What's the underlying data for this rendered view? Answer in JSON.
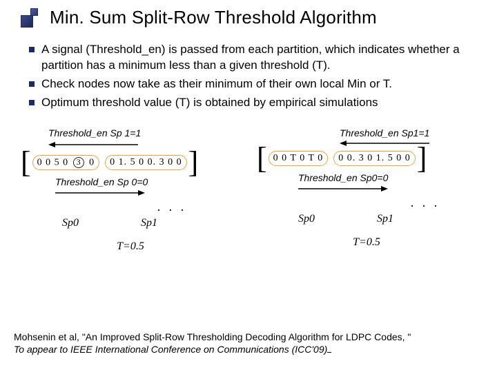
{
  "title": "Min. Sum Split-Row Threshold Algorithm",
  "bullets": [
    "A signal (Threshold_en) is passed from each partition, which indicates whether a partition has a minimum less than a given threshold (T).",
    "Check nodes now take as their minimum of their own local Min or T.",
    "Optimum threshold value (T) is obtained by empirical simulations"
  ],
  "left": {
    "th_top": "Threshold_en Sp 1=1",
    "pill_left": "0 0 5 0",
    "circled": "3",
    "pill_left_tail": "0",
    "pill_right": "0 1. 5 0 0. 3 0 0",
    "th_bottom": "Threshold_en Sp 0=0",
    "sp0": "Sp0",
    "sp1": "Sp1",
    "tval": "T=0.5"
  },
  "right": {
    "th_top": "Threshold_en Sp1=1",
    "pill_left": "0 0 T 0 T 0",
    "pill_right": "0 0. 3 0 1. 5 0 0",
    "th_bottom": "Threshold_en Sp0=0",
    "sp0": "Sp0",
    "sp1": "Sp1",
    "tval": "T=0.5"
  },
  "dots": ". . .",
  "citation_a": "Mohsenin et al, \"An Improved Split-Row Thresholding Decoding Algorithm for LDPC Codes, \"",
  "citation_b": "To appear to IEEE International Conference on Communications (ICC'09)"
}
